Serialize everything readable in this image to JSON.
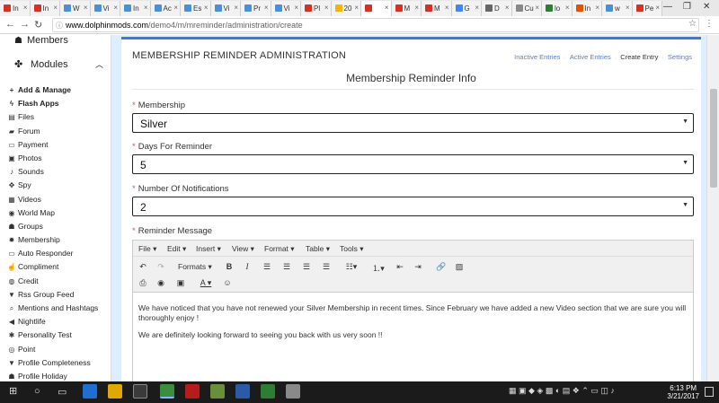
{
  "browser": {
    "tabs": [
      {
        "label": "In",
        "color": "#d93025"
      },
      {
        "label": "In",
        "color": "#d93025"
      },
      {
        "label": "W",
        "color": "#4a90d9"
      },
      {
        "label": "Vi",
        "color": "#4a90d9"
      },
      {
        "label": "In",
        "color": "#4a90d9"
      },
      {
        "label": "Ac",
        "color": "#4a90d9"
      },
      {
        "label": "Es",
        "color": "#4a90d9"
      },
      {
        "label": "Vi",
        "color": "#4a90d9"
      },
      {
        "label": "Pr",
        "color": "#4a90d9"
      },
      {
        "label": "Vi",
        "color": "#4a90d9"
      },
      {
        "label": "Pl",
        "color": "#d93025"
      },
      {
        "label": "20",
        "color": "#f4b400"
      },
      {
        "label": "",
        "color": "#d93025"
      },
      {
        "label": "M",
        "color": "#d93025"
      },
      {
        "label": "M",
        "color": "#d93025"
      },
      {
        "label": "G",
        "color": "#4285f4"
      },
      {
        "label": "D",
        "color": "#666666"
      },
      {
        "label": "Cu",
        "color": "#888888"
      },
      {
        "label": "lo",
        "color": "#2e7d32"
      },
      {
        "label": "In",
        "color": "#e65100"
      },
      {
        "label": "w",
        "color": "#4a90d9"
      },
      {
        "label": "Pe",
        "color": "#d93025"
      }
    ],
    "url_domain": "www.dolphinmods.com",
    "url_path": "/demo4/m/mreminder/administration/create"
  },
  "sidebar": {
    "members_label": "Members",
    "modules_label": "Modules",
    "items": [
      {
        "label": "Add & Manage",
        "icon": "+",
        "bold": true
      },
      {
        "label": "Flash Apps",
        "icon": "ϟ",
        "bold": true
      },
      {
        "label": "Files",
        "icon": "▤",
        "bold": false
      },
      {
        "label": "Forum",
        "icon": "▰",
        "bold": false
      },
      {
        "label": "Payment",
        "icon": "▭",
        "bold": false
      },
      {
        "label": "Photos",
        "icon": "▣",
        "bold": false
      },
      {
        "label": "Sounds",
        "icon": "♪",
        "bold": false
      },
      {
        "label": "Spy",
        "icon": "✥",
        "bold": false
      },
      {
        "label": "Videos",
        "icon": "▦",
        "bold": false
      },
      {
        "label": "World Map",
        "icon": "◉",
        "bold": false
      },
      {
        "label": "Groups",
        "icon": "☗",
        "bold": false
      },
      {
        "label": "Membership",
        "icon": "✹",
        "bold": false
      },
      {
        "label": "Auto Responder",
        "icon": "▭",
        "bold": false
      },
      {
        "label": "Compliment",
        "icon": "☝",
        "bold": false
      },
      {
        "label": "Credit",
        "icon": "◍",
        "bold": false
      },
      {
        "label": "Rss Group Feed",
        "icon": "▼",
        "bold": false
      },
      {
        "label": "Mentions and Hashtags",
        "icon": "⌕",
        "bold": false
      },
      {
        "label": "Nightlife",
        "icon": "◀",
        "bold": false
      },
      {
        "label": "Personality Test",
        "icon": "✱",
        "bold": false
      },
      {
        "label": "Point",
        "icon": "◎",
        "bold": false
      },
      {
        "label": "Profile Completeness",
        "icon": "▼",
        "bold": false
      },
      {
        "label": "Profile Holiday",
        "icon": "☗",
        "bold": false
      }
    ]
  },
  "content": {
    "admin_title": "MEMBERSHIP REMINDER ADMINISTRATION",
    "crumbs": {
      "inactive": "Inactive Entries",
      "active": "Active Entries",
      "create": "Create Entry",
      "settings": "Settings"
    },
    "section_title": "Membership Reminder Info",
    "fields": {
      "membership_label": "Membership",
      "membership_value": "Silver",
      "days_label": "Days For Reminder",
      "days_value": "5",
      "notif_label": "Number Of Notifications",
      "notif_value": "2",
      "message_label": "Reminder Message"
    },
    "editor": {
      "menus": [
        "File",
        "Edit",
        "Insert",
        "View",
        "Format",
        "Table",
        "Tools"
      ],
      "formats_label": "Formats",
      "para1": "We have noticed that you have not renewed your Silver Membership in recent times. Since February we have added a new Video section that we are sure you will thoroughly enjoy !",
      "para2": "We are definitely looking forward to seeing you back with us very soon !!"
    }
  },
  "taskbar": {
    "time": "6:13 PM",
    "date": "3/21/2017"
  }
}
